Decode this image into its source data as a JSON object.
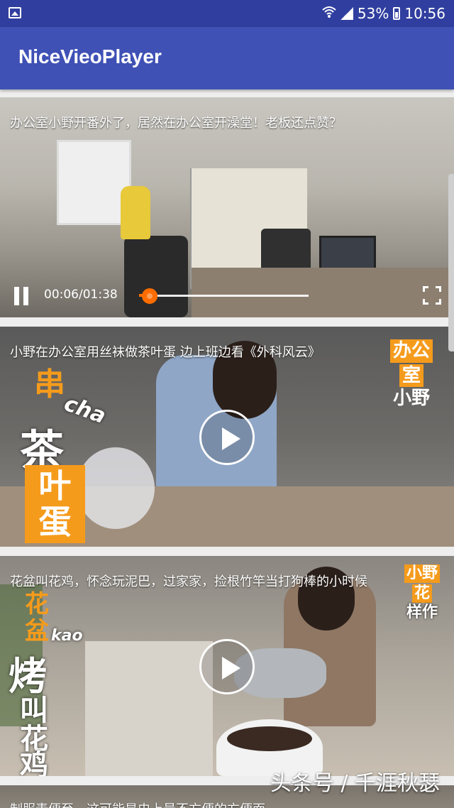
{
  "status_bar": {
    "battery": "53%",
    "time": "10:56",
    "icons": [
      "gallery-icon",
      "wifi-icon",
      "signal-icon",
      "battery-icon"
    ]
  },
  "app_bar": {
    "title": "NiceVieoPlayer"
  },
  "videos": [
    {
      "title": "办公室小野开番外了，居然在办公室开澡堂！老板还点赞？",
      "state": "playing",
      "time": "00:06/01:38",
      "progress_fraction": 0.06
    },
    {
      "title": "小野在办公室用丝袜做茶叶蛋 边上班边看《外科风云》",
      "state": "paused",
      "overlay": {
        "c1": "串",
        "c2": "cha",
        "c3": "茶",
        "c4": "叶",
        "c5": "蛋",
        "badge_l1": "办公",
        "badge_l2": "室",
        "badge_l3": "小野"
      }
    },
    {
      "title": "花盆叫花鸡，怀念玩泥巴，过家家，捡根竹竿当打狗棒的小时候",
      "state": "paused",
      "overlay": {
        "c1": "花",
        "c2": "盆",
        "c3": "kao",
        "c4": "烤",
        "c5": "叫",
        "c6": "花",
        "c7": "鸡",
        "badge_l1": "小野",
        "badge_l2": "花",
        "badge_l3": "样作"
      }
    },
    {
      "title": "制服麦便至，这可能是史上最不方便的方便面"
    }
  ],
  "watermark": "头条号 / 千涯秋瑟",
  "colors": {
    "primary_dark": "#303f9f",
    "primary": "#3f51b5",
    "accent": "#ff6d00",
    "badge": "#f59b1c"
  }
}
